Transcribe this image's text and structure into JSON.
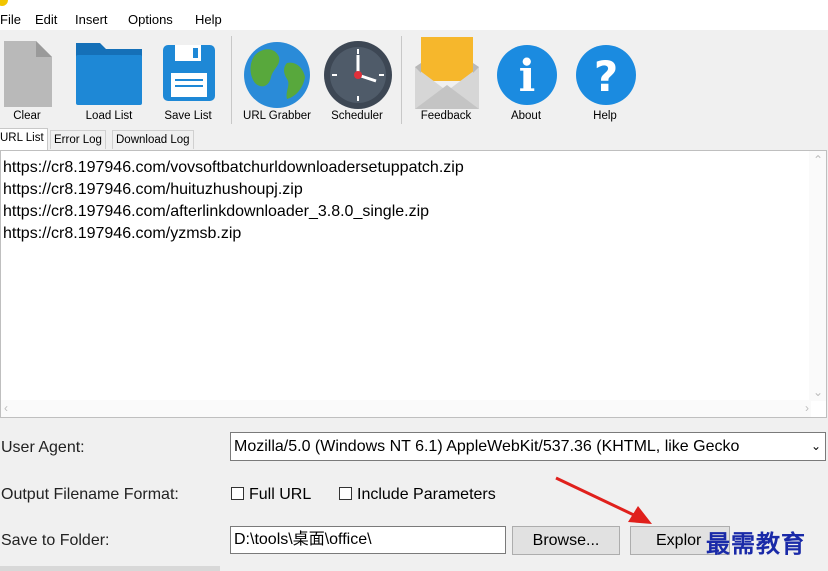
{
  "menu": [
    "File",
    "Edit",
    "Insert",
    "Options",
    "Help"
  ],
  "toolbar": {
    "clear": "Clear",
    "load_list": "Load List",
    "save_list": "Save List",
    "url_grabber": "URL Grabber",
    "scheduler": "Scheduler",
    "feedback": "Feedback",
    "about": "About",
    "help": "Help"
  },
  "tabs": [
    "URL List",
    "Error Log",
    "Download Log"
  ],
  "urls": [
    "https://cr8.197946.com/vovsoftbatchurldownloadersetuppatch.zip",
    "https://cr8.197946.com/huituzhushoupj.zip",
    "https://cr8.197946.com/afterlinkdownloader_3.8.0_single.zip",
    "https://cr8.197946.com/yzmsb.zip"
  ],
  "options": {
    "user_agent_label": "User Agent:",
    "user_agent_value": "Mozilla/5.0 (Windows NT 6.1) AppleWebKit/537.36 (KHTML, like Gecko",
    "filename_format_label": "Output Filename Format:",
    "full_url_label": "Full URL",
    "include_params_label": "Include Parameters",
    "save_folder_label": "Save to Folder:",
    "save_folder_value": "D:\\tools\\桌面\\office\\",
    "browse_label": "Browse...",
    "explore_label": "Explor"
  },
  "watermark": "最需教育",
  "colors": {
    "folder_blue": "#1e88d6",
    "about_blue": "#1b8be0",
    "watermark": "#1a2aa8",
    "arrow_red": "#e0201c"
  },
  "icons": [
    "document-icon",
    "folder-icon",
    "floppy-disk-icon",
    "globe-icon",
    "clock-icon",
    "envelope-icon",
    "info-icon",
    "question-icon"
  ]
}
